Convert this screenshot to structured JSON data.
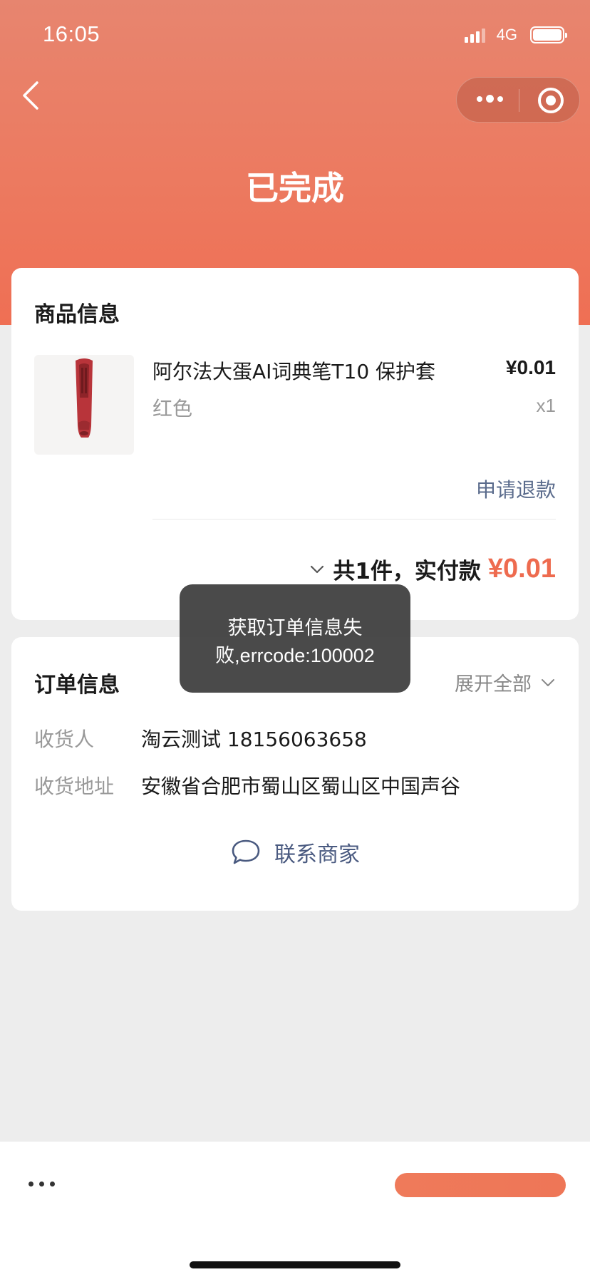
{
  "status_bar": {
    "time": "16:05",
    "network": "4G"
  },
  "header": {
    "title": "已完成"
  },
  "product_section": {
    "title": "商品信息",
    "item": {
      "name": "阿尔法大蛋AI词典笔T10 保护套",
      "spec": "红色",
      "price": "¥0.01",
      "quantity": "x1",
      "refund_label": "申请退款"
    },
    "total": {
      "label": "共1件，实付款",
      "amount": "¥0.01"
    }
  },
  "order_section": {
    "title": "订单信息",
    "expand_label": "展开全部",
    "fields": [
      {
        "label": "收货人",
        "value": "淘云测试 18156063658"
      },
      {
        "label": "收货地址",
        "value": "安徽省合肥市蜀山区蜀山区中国声谷"
      }
    ],
    "contact_label": "联系商家"
  },
  "toast": {
    "line1": "获取订单信息失",
    "line2": "败,errcode:100002"
  },
  "colors": {
    "accent": "#ee6b4f",
    "link": "#5a6b8c",
    "header_gradient_top": "#e7856f",
    "header_gradient_bottom": "#ef6f54"
  }
}
